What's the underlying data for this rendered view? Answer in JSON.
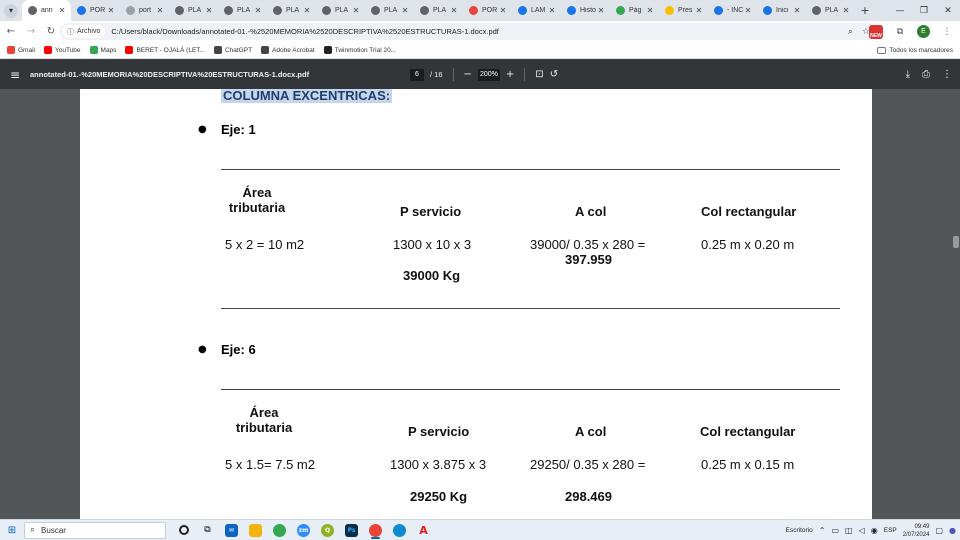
{
  "browser": {
    "tabs": [
      {
        "title": "ann",
        "icon": "chrome-icon",
        "color": "#5f6368",
        "active": true
      },
      {
        "title": "POR",
        "icon": "slides-icon",
        "color": "#1a73e8",
        "active": false
      },
      {
        "title": "port",
        "icon": "google-icon",
        "color": "#9aa0a6",
        "active": false
      },
      {
        "title": "PLA",
        "icon": "chrome-icon",
        "color": "#5f6368",
        "active": false
      },
      {
        "title": "PLA",
        "icon": "chrome-icon",
        "color": "#5f6368",
        "active": false
      },
      {
        "title": "PLA",
        "icon": "chrome-icon",
        "color": "#5f6368",
        "active": false
      },
      {
        "title": "PLA",
        "icon": "chrome-icon",
        "color": "#5f6368",
        "active": false
      },
      {
        "title": "PLA",
        "icon": "chrome-icon",
        "color": "#5f6368",
        "active": false
      },
      {
        "title": "PLA",
        "icon": "chrome-icon",
        "color": "#5f6368",
        "active": false
      },
      {
        "title": "POR",
        "icon": "target-icon",
        "color": "#e8453c",
        "active": false
      },
      {
        "title": "LAM",
        "icon": "arrows-icon",
        "color": "#1a73e8",
        "active": false
      },
      {
        "title": "Histo",
        "icon": "download-icon",
        "color": "#1a73e8",
        "active": false
      },
      {
        "title": "Pág",
        "icon": "puzzle-icon",
        "color": "#34a853",
        "active": false
      },
      {
        "title": "Pres",
        "icon": "slides-yellow-icon",
        "color": "#fbbc04",
        "active": false
      },
      {
        "title": "- INC",
        "icon": "arrows-icon",
        "color": "#1a73e8",
        "active": false
      },
      {
        "title": "Inici",
        "icon": "edge-icon",
        "color": "#1a73e8",
        "active": false
      },
      {
        "title": "PLA",
        "icon": "chrome-icon",
        "color": "#5f6368",
        "active": false
      }
    ],
    "site_chip": "Archivo",
    "url": "C:/Users/black/Downloads/annotated-01.-%2520MEMORIA%2520DESCRIPTIVA%2520ESTRUCTURAS-1.docx.pdf",
    "new_badge": "NEW",
    "avatar_letter": "E",
    "bookmarks": [
      {
        "label": "Gmail",
        "icon": "gmail-icon",
        "color": "#ea4335"
      },
      {
        "label": "YouTube",
        "icon": "youtube-icon",
        "color": "#ff0000"
      },
      {
        "label": "Maps",
        "icon": "maps-icon",
        "color": "#34a853"
      },
      {
        "label": "BERET - OJALÁ (LET...",
        "icon": "youtube-icon",
        "color": "#ff0000"
      },
      {
        "label": "ChatGPT",
        "icon": "chatgpt-icon",
        "color": "#444444"
      },
      {
        "label": "Adobe Acrobat",
        "icon": "acrobat-icon",
        "color": "#444444"
      },
      {
        "label": "Twinmotion Trial 20...",
        "icon": "twinmotion-icon",
        "color": "#222222"
      }
    ],
    "all_bookmarks": "Todos los marcadores"
  },
  "pdf": {
    "filename": "annotated-01.-%20MEMORIA%20DESCRIPTIVA%20ESTRUCTURAS-1.docx.pdf",
    "current_page": "6",
    "total_pages": "/ 16",
    "zoom": "200%"
  },
  "document": {
    "heading": "COLUMNA EXCENTRICAS:",
    "sections": [
      {
        "bullet": "Eje: 1",
        "col1": [
          "Área",
          "tributaria"
        ],
        "headers": [
          "P servicio",
          "A col",
          "Col rectangular"
        ],
        "area": "5 x 2 = 10 m2",
        "p_servicio": "1300 x 10 x 3",
        "p_total": "39000 Kg",
        "a_col": "39000/ 0.35 x 280 =",
        "a_col_result": "397.959",
        "col_rect": "0.25 m x 0.20 m"
      },
      {
        "bullet": "Eje: 6",
        "col1": [
          "Área",
          "tributaria"
        ],
        "headers": [
          "P servicio",
          "A col",
          "Col rectangular"
        ],
        "area": "5 x 1.5= 7.5 m2",
        "p_servicio": "1300 x 3.875 x 3",
        "p_total": "29250 Kg",
        "a_col": "29250/ 0.35 x 280 =",
        "a_col_result": "298.469",
        "col_rect": "0.25 m x 0.15 m"
      }
    ]
  },
  "taskbar": {
    "search_placeholder": "Buscar",
    "desktop_label": "Escritorio",
    "language": "ESP",
    "time": "09:49",
    "date": "2/07/2024"
  },
  "colors": {
    "highlight": "#c5d6ec",
    "heading_text": "#1f3f6b",
    "pdf_toolbar": "#323639",
    "viewport_bg": "#525659"
  }
}
